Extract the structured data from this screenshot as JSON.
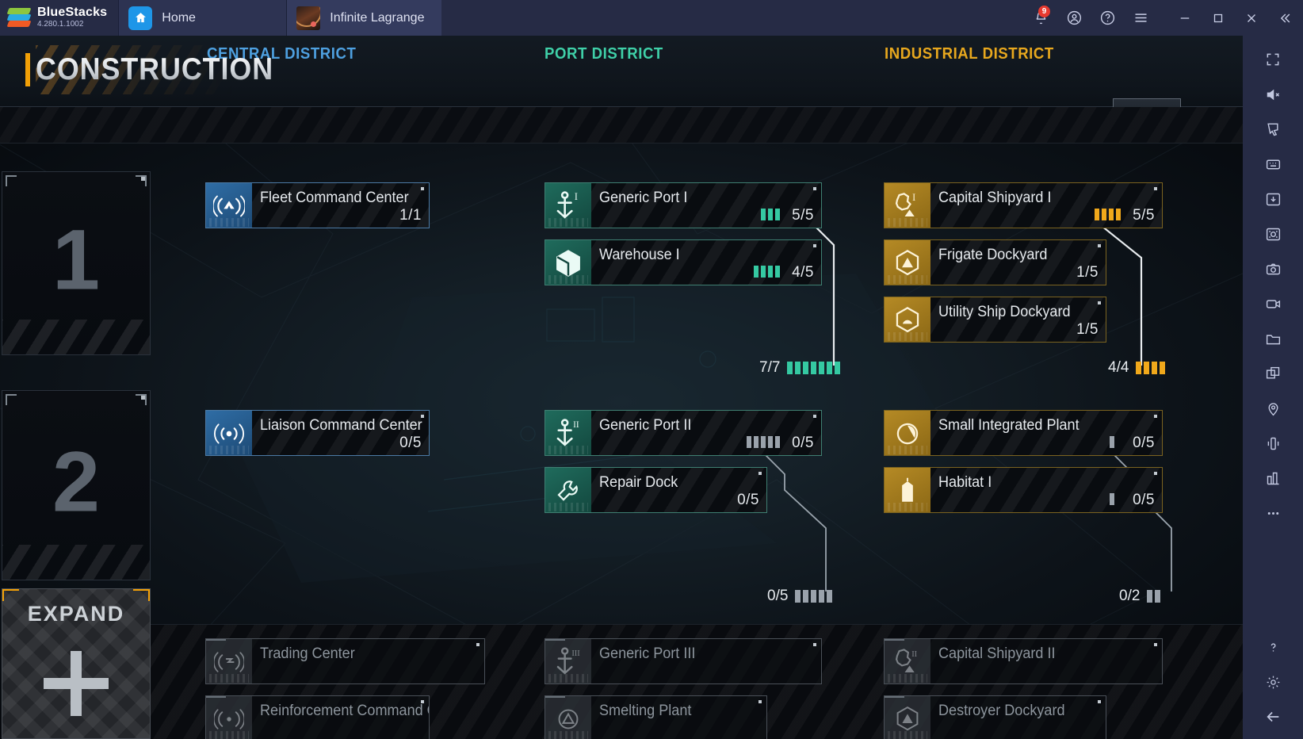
{
  "titlebar": {
    "brand": "BlueStacks",
    "version": "4.280.1.1002",
    "tabs": [
      {
        "label": "Home",
        "icon": "home-icon"
      },
      {
        "label": "Infinite Lagrange",
        "icon": "game-thumbnail"
      }
    ],
    "notification_badge": "9",
    "controls": [
      "bell-icon",
      "account-icon",
      "help-icon",
      "menu-icon",
      "minimize-icon",
      "maximize-icon",
      "close-icon",
      "collapse-icon"
    ]
  },
  "sidebar": {
    "items": [
      "fullscreen-icon",
      "mute-icon",
      "cursor-icon",
      "keymap-icon",
      "install-apk-icon",
      "screenshot-icon",
      "camera-icon",
      "record-icon",
      "folder-icon",
      "multi-instance-icon",
      "location-icon",
      "shake-icon",
      "layout-icon",
      "more-icon",
      "help-icon",
      "settings-icon",
      "back-icon"
    ]
  },
  "header": {
    "title": "CONSTRUCTION",
    "collapse_label": "chevron-down-icon"
  },
  "districts": [
    {
      "key": "central",
      "label": "CENTRAL DISTRICT",
      "color": "#4ea0e0"
    },
    {
      "key": "port",
      "label": "PORT DISTRICT",
      "color": "#3fd0a8"
    },
    {
      "key": "industrial",
      "label": "INDUSTRIAL DISTRICT",
      "color": "#e8a81e"
    }
  ],
  "tiers": [
    {
      "number": "1"
    },
    {
      "number": "2"
    }
  ],
  "expand": {
    "label": "EXPAND",
    "icon": "plus-icon"
  },
  "buildings": {
    "tier1": {
      "central": [
        {
          "name": "Fleet Command Center",
          "count": "1/1",
          "icon": "signal-icon",
          "bars": 0,
          "bar_color": ""
        }
      ],
      "port": [
        {
          "name": "Generic Port I",
          "count": "5/5",
          "icon": "anchor-one-icon",
          "bars": 3,
          "bar_color": "#35c9a2"
        },
        {
          "name": "Warehouse I",
          "count": "4/5",
          "icon": "cube-icon",
          "bars": 4,
          "bar_color": "#35c9a2"
        }
      ],
      "industrial": [
        {
          "name": "Capital Shipyard I",
          "count": "5/5",
          "icon": "gear-one-icon",
          "bars": 4,
          "bar_color": "#f0a81b"
        },
        {
          "name": "Frigate Dockyard",
          "count": "1/5",
          "icon": "hex-triangle-icon",
          "bars": 0,
          "bar_color": ""
        },
        {
          "name": "Utility Ship Dockyard",
          "count": "1/5",
          "icon": "hex-dome-icon",
          "bars": 0,
          "bar_color": ""
        }
      ]
    },
    "tier2": {
      "central": [
        {
          "name": "Liaison Command Center",
          "count": "0/5",
          "icon": "signal-dish-icon",
          "bars": 0,
          "bar_color": ""
        }
      ],
      "port": [
        {
          "name": "Generic Port II",
          "count": "0/5",
          "icon": "anchor-two-icon",
          "bars": 5,
          "bar_color": "#9aa2ab"
        },
        {
          "name": "Repair Dock",
          "count": "0/5",
          "icon": "wrench-icon",
          "bars": 0,
          "bar_color": ""
        }
      ],
      "industrial": [
        {
          "name": "Small Integrated Plant",
          "count": "0/5",
          "icon": "plant-icon",
          "bars": 1,
          "bar_color": "#9aa2ab"
        },
        {
          "name": "Habitat I",
          "count": "0/5",
          "icon": "habitat-icon",
          "bars": 1,
          "bar_color": "#9aa2ab"
        }
      ]
    },
    "locked": {
      "central": [
        {
          "name": "Trading Center",
          "icon": "signal-trade-icon"
        },
        {
          "name": "Reinforcement Command Center",
          "icon": "signal-reinforce-icon"
        }
      ],
      "port": [
        {
          "name": "Generic Port III",
          "icon": "anchor-three-icon"
        },
        {
          "name": "Smelting Plant",
          "icon": "smelting-icon"
        }
      ],
      "industrial": [
        {
          "name": "Capital Shipyard II",
          "icon": "gear-two-icon"
        },
        {
          "name": "Destroyer Dockyard",
          "icon": "hex-triangle-icon"
        }
      ]
    }
  },
  "summaries": {
    "tier1_port": {
      "count": "7/7",
      "bars": 7,
      "bar_color": "#35c9a2"
    },
    "tier1_industrial": {
      "count": "4/4",
      "bars": 4,
      "bar_color": "#f0a81b"
    },
    "tier2_port": {
      "count": "0/5",
      "bars": 5,
      "bar_color": "#9aa2ab"
    },
    "tier2_industrial": {
      "count": "0/2",
      "bars": 2,
      "bar_color": "#9aa2ab"
    }
  }
}
